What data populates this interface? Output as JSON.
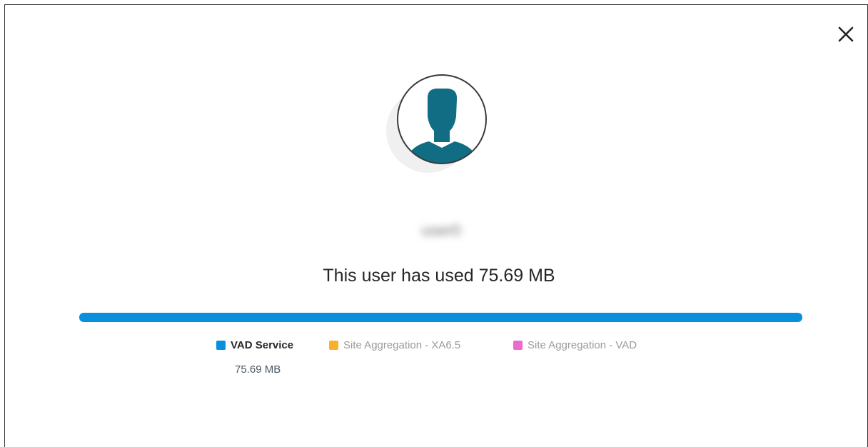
{
  "dialog": {
    "close_icon": "close-icon",
    "avatar_icon": "user-avatar-icon",
    "username": "user0",
    "usage_text": "This user has used 75.69 MB",
    "usage_fill_fraction": 1.0,
    "bar_color": "#0a8fdf",
    "legend": [
      {
        "label": "VAD Service",
        "color": "#0a8fdf",
        "value": "75.69 MB"
      },
      {
        "label": "Site Aggregation - XA6.5",
        "color": "#f9b12a"
      },
      {
        "label": "Site Aggregation - VAD",
        "color": "#ee6ad0"
      }
    ]
  }
}
